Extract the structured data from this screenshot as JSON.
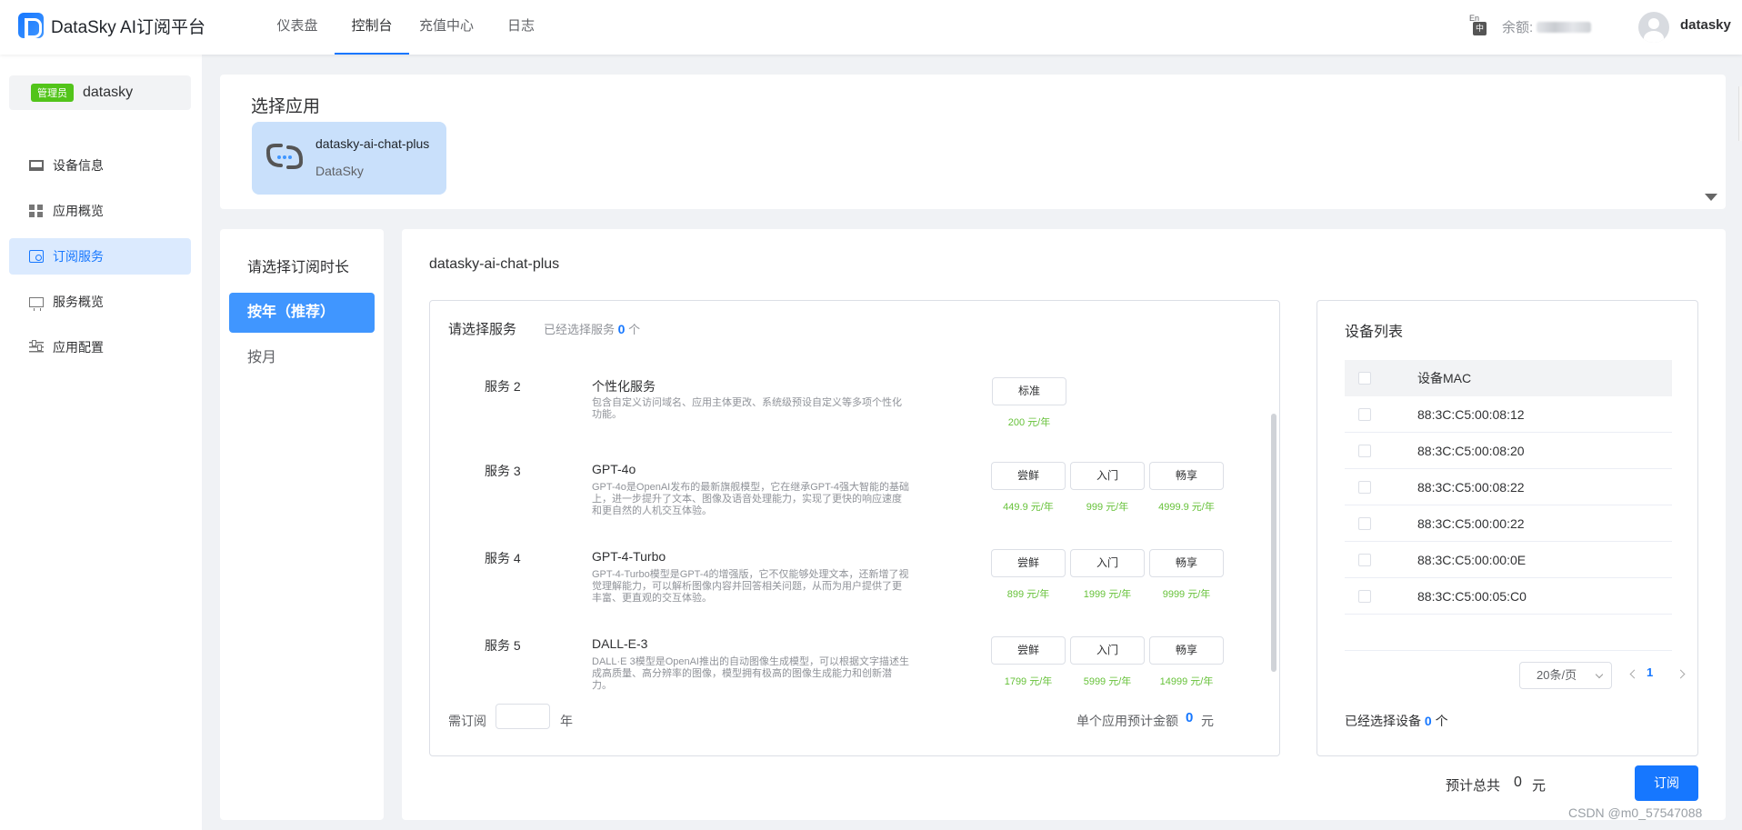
{
  "header": {
    "app_title": "DataSky AI订阅平台",
    "nav": [
      "仪表盘",
      "控制台",
      "充值中心",
      "日志"
    ],
    "lang_en": "En",
    "lang_zh": "中",
    "balance_label": "余额:",
    "username": "datasky"
  },
  "sidebar": {
    "badge": "管理员",
    "user": "datasky",
    "items": [
      {
        "label": "设备信息"
      },
      {
        "label": "应用概览"
      },
      {
        "label": "订阅服务"
      },
      {
        "label": "服务概览"
      },
      {
        "label": "应用配置"
      }
    ]
  },
  "app_select": {
    "title": "选择应用",
    "card": {
      "name": "datasky-ai-chat-plus",
      "vendor": "DataSky"
    }
  },
  "duration": {
    "title": "请选择订阅时长",
    "options": [
      "按年（推荐）",
      "按月"
    ]
  },
  "main": {
    "app_name": "datasky-ai-chat-plus",
    "services": {
      "title": "请选择服务",
      "selected_prefix": "已经选择服务",
      "selected_count": "0",
      "selected_suffix": "个",
      "rows": [
        {
          "num": "服务 2",
          "name": "个性化服务",
          "desc": "包含自定义访问域名、应用主体更改、系统级预设自定义等多项个性化功能。",
          "tiers": [
            {
              "label": "标准",
              "price": "200 元/年"
            }
          ]
        },
        {
          "num": "服务 3",
          "name": "GPT-4o",
          "desc": "GPT-4o是OpenAI发布的最新旗舰模型，它在继承GPT-4强大智能的基础上，进一步提升了文本、图像及语音处理能力，实现了更快的响应速度和更自然的人机交互体验。",
          "tiers": [
            {
              "label": "尝鲜",
              "price": "449.9 元/年"
            },
            {
              "label": "入门",
              "price": "999 元/年"
            },
            {
              "label": "畅享",
              "price": "4999.9 元/年"
            }
          ]
        },
        {
          "num": "服务 4",
          "name": "GPT-4-Turbo",
          "desc": "GPT-4-Turbo模型是GPT-4的增强版，它不仅能够处理文本，还新增了视觉理解能力，可以解析图像内容并回答相关问题，从而为用户提供了更丰富、更直观的交互体验。",
          "tiers": [
            {
              "label": "尝鲜",
              "price": "899 元/年"
            },
            {
              "label": "入门",
              "price": "1999 元/年"
            },
            {
              "label": "畅享",
              "price": "9999 元/年"
            }
          ]
        },
        {
          "num": "服务 5",
          "name": "DALL-E-3",
          "desc": "DALL·E 3模型是OpenAI推出的自动图像生成模型，可以根据文字描述生成高质量、高分辨率的图像，模型拥有极高的图像生成能力和创新潜力。",
          "tiers": [
            {
              "label": "尝鲜",
              "price": "1799 元/年"
            },
            {
              "label": "入门",
              "price": "5999 元/年"
            },
            {
              "label": "畅享",
              "price": "14999 元/年"
            }
          ]
        }
      ],
      "footer": {
        "need_label": "需订阅",
        "years_value": "",
        "years_unit": "年",
        "estimate_label": "单个应用预计金额",
        "estimate_value": "0",
        "estimate_unit": "元"
      }
    },
    "devices": {
      "title": "设备列表",
      "column": "设备MAC",
      "rows": [
        "88:3C:C5:00:08:12",
        "88:3C:C5:00:08:20",
        "88:3C:C5:00:08:22",
        "88:3C:C5:00:00:22",
        "88:3C:C5:00:00:0E",
        "88:3C:C5:00:05:C0"
      ],
      "page_size": "20条/页",
      "page": "1",
      "selected_prefix": "已经选择设备",
      "selected_count": "0",
      "selected_suffix": "个"
    },
    "total": {
      "label": "预计总共",
      "value": "0",
      "unit": "元"
    },
    "subscribe_button": "订阅"
  },
  "watermark": "CSDN @m0_57547088",
  "colors": {
    "accent": "#1677ff",
    "price": "#67c23a",
    "admin_badge": "#52c41a",
    "app_card": "#c9e0fb"
  }
}
